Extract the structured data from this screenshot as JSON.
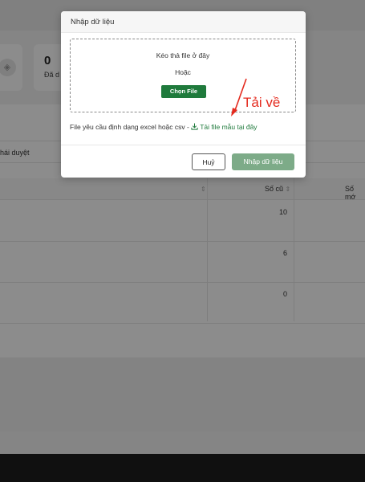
{
  "background": {
    "stat_value": "0",
    "stat_label": "Đã d",
    "tab_label": "hái duyệt",
    "columns": [
      "Số cũ",
      "Số mớ"
    ],
    "rows": [
      {
        "old": "10"
      },
      {
        "old": "6"
      },
      {
        "old": "0"
      }
    ]
  },
  "modal": {
    "title": "Nhập dữ liệu",
    "drop_text": "Kéo thả file ở đây",
    "or_text": "Hoặc",
    "choose_label": "Chọn File",
    "requirement_text": "File yêu cầu định dạng excel hoặc csv - ",
    "download_link": "Tải file mẫu tại đây",
    "cancel_label": "Huỷ",
    "import_label": "Nhập dữ liệu"
  },
  "annotation": {
    "text": "Tải về",
    "color": "#e42a1e"
  },
  "colors": {
    "accent": "#1f7a3c",
    "import_button": "#7dab88"
  },
  "icons": {
    "download": "download-icon",
    "stat": "stat-icon",
    "sort": "sort-icon"
  }
}
